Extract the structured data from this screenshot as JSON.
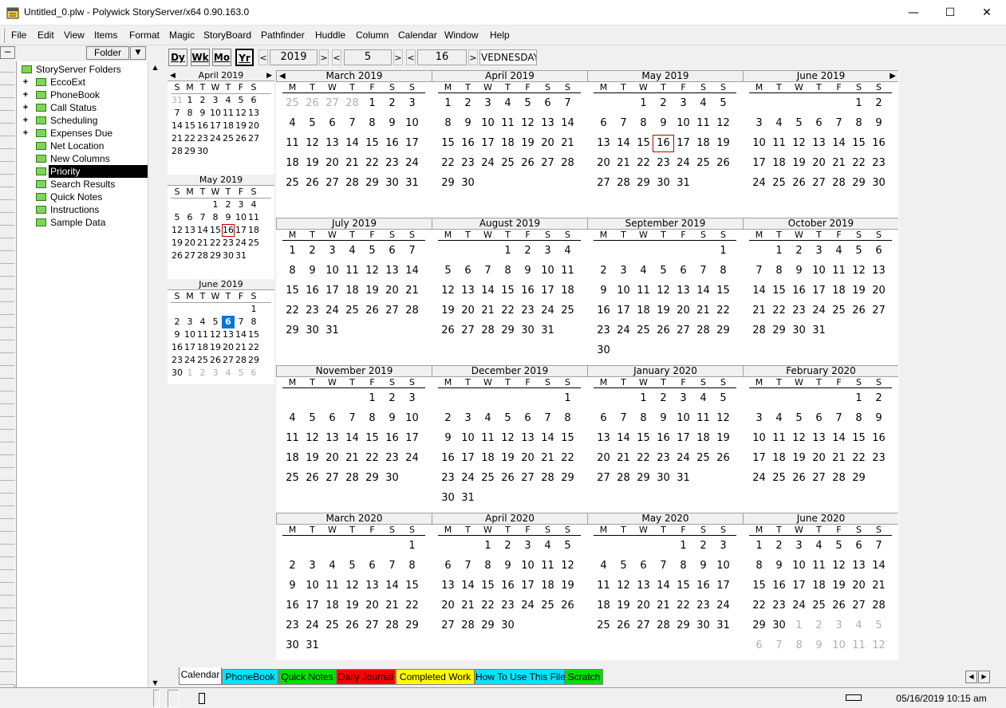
{
  "window": {
    "title": "Untitled_0.plw - Polywick StoryServer/x64 0.90.163.0",
    "minimize": "—",
    "maximize": "☐",
    "close": "✕"
  },
  "menu": [
    "File",
    "Edit",
    "View",
    "Items",
    "Format",
    "Magic",
    "StoryBoard",
    "Pathfinder",
    "Huddle",
    "Column",
    "Calendar",
    "Window",
    "Help"
  ],
  "leftpane": {
    "collapse": "−",
    "header": "Folder",
    "dropdown": "▼",
    "tree": [
      {
        "label": "StoryServer Folders",
        "level": 0,
        "plus": false,
        "selected": false
      },
      {
        "label": "EccoExt",
        "level": 1,
        "plus": true,
        "selected": false
      },
      {
        "label": "PhoneBook",
        "level": 1,
        "plus": true,
        "selected": false
      },
      {
        "label": "Call Status",
        "level": 1,
        "plus": true,
        "selected": false
      },
      {
        "label": "Scheduling",
        "level": 1,
        "plus": true,
        "selected": false
      },
      {
        "label": "Expenses Due",
        "level": 1,
        "plus": true,
        "selected": false
      },
      {
        "label": "Net Location",
        "level": 1,
        "plus": false,
        "selected": false
      },
      {
        "label": "New Columns",
        "level": 1,
        "plus": false,
        "selected": false
      },
      {
        "label": "Priority",
        "level": 1,
        "plus": false,
        "selected": true
      },
      {
        "label": "Search Results",
        "level": 1,
        "plus": false,
        "selected": false
      },
      {
        "label": "Quick Notes",
        "level": 1,
        "plus": false,
        "selected": false
      },
      {
        "label": "Instructions",
        "level": 1,
        "plus": false,
        "selected": false
      },
      {
        "label": "Sample Data",
        "level": 1,
        "plus": false,
        "selected": false
      }
    ]
  },
  "toolbar": {
    "day": "Dy",
    "week": "Wk",
    "month": "Mo",
    "year": "Yr",
    "year_value": "2019",
    "month_value": "5",
    "day_value": "16",
    "weekday": "VEDNESDAY"
  },
  "mini": [
    {
      "title": "April 2019",
      "head": [
        "S",
        "M",
        "T",
        "W",
        "T",
        "F",
        "S"
      ],
      "weeks": [
        [
          "31",
          "1",
          "2",
          "3",
          "4",
          "5",
          "6"
        ],
        [
          "7",
          "8",
          "9",
          "10",
          "11",
          "12",
          "13"
        ],
        [
          "14",
          "15",
          "16",
          "17",
          "18",
          "19",
          "20"
        ],
        [
          "21",
          "22",
          "23",
          "24",
          "25",
          "26",
          "27"
        ],
        [
          "28",
          "29",
          "30",
          "",
          "",
          "",
          ""
        ]
      ],
      "dim_first": 1
    },
    {
      "title": "May 2019",
      "head": [
        "S",
        "M",
        "T",
        "W",
        "T",
        "F",
        "S"
      ],
      "weeks": [
        [
          "",
          "",
          "",
          "1",
          "2",
          "3",
          "4"
        ],
        [
          "5",
          "6",
          "7",
          "8",
          "9",
          "10",
          "11"
        ],
        [
          "12",
          "13",
          "14",
          "15",
          "16",
          "17",
          "18"
        ],
        [
          "19",
          "20",
          "21",
          "22",
          "23",
          "24",
          "25"
        ],
        [
          "26",
          "27",
          "28",
          "29",
          "30",
          "31",
          ""
        ]
      ],
      "dim_first": 0
    },
    {
      "title": "June 2019",
      "head": [
        "S",
        "M",
        "T",
        "W",
        "T",
        "F",
        "S"
      ],
      "weeks": [
        [
          "",
          "",
          "",
          "",
          "",
          "",
          "1"
        ],
        [
          "2",
          "3",
          "4",
          "5",
          "6",
          "7",
          "8"
        ],
        [
          "9",
          "10",
          "11",
          "12",
          "13",
          "14",
          "15"
        ],
        [
          "16",
          "17",
          "18",
          "19",
          "20",
          "21",
          "22"
        ],
        [
          "23",
          "24",
          "25",
          "26",
          "27",
          "28",
          "29"
        ],
        [
          "30",
          "1",
          "2",
          "3",
          "4",
          "5",
          "6"
        ]
      ],
      "dim_first": 0
    }
  ],
  "year": {
    "head": [
      "M",
      "T",
      "W",
      "T",
      "F",
      "S",
      "S"
    ],
    "months": [
      {
        "title": "March 2019",
        "weeks": [
          [
            "25",
            "26",
            "27",
            "28",
            "1",
            "2",
            "3"
          ],
          [
            "4",
            "5",
            "6",
            "7",
            "8",
            "9",
            "10"
          ],
          [
            "11",
            "12",
            "13",
            "14",
            "15",
            "16",
            "17"
          ],
          [
            "18",
            "19",
            "20",
            "21",
            "22",
            "23",
            "24"
          ],
          [
            "25",
            "26",
            "27",
            "28",
            "29",
            "30",
            "31"
          ]
        ]
      },
      {
        "title": "April 2019",
        "weeks": [
          [
            "1",
            "2",
            "3",
            "4",
            "5",
            "6",
            "7"
          ],
          [
            "8",
            "9",
            "10",
            "11",
            "12",
            "13",
            "14"
          ],
          [
            "15",
            "16",
            "17",
            "18",
            "19",
            "20",
            "21"
          ],
          [
            "22",
            "23",
            "24",
            "25",
            "26",
            "27",
            "28"
          ],
          [
            "29",
            "30",
            "",
            "",
            "",
            "",
            ""
          ]
        ]
      },
      {
        "title": "May 2019",
        "weeks": [
          [
            "",
            "",
            "1",
            "2",
            "3",
            "4",
            "5"
          ],
          [
            "6",
            "7",
            "8",
            "9",
            "10",
            "11",
            "12"
          ],
          [
            "13",
            "14",
            "15",
            "16",
            "17",
            "18",
            "19"
          ],
          [
            "20",
            "21",
            "22",
            "23",
            "24",
            "25",
            "26"
          ],
          [
            "27",
            "28",
            "29",
            "30",
            "31",
            "",
            ""
          ]
        ]
      },
      {
        "title": "June 2019",
        "weeks": [
          [
            "",
            "",
            "",
            "",
            "",
            "1",
            "2"
          ],
          [
            "3",
            "4",
            "5",
            "6",
            "7",
            "8",
            "9"
          ],
          [
            "10",
            "11",
            "12",
            "13",
            "14",
            "15",
            "16"
          ],
          [
            "17",
            "18",
            "19",
            "20",
            "21",
            "22",
            "23"
          ],
          [
            "24",
            "25",
            "26",
            "27",
            "28",
            "29",
            "30"
          ]
        ]
      },
      {
        "title": "July 2019",
        "weeks": [
          [
            "1",
            "2",
            "3",
            "4",
            "5",
            "6",
            "7"
          ],
          [
            "8",
            "9",
            "10",
            "11",
            "12",
            "13",
            "14"
          ],
          [
            "15",
            "16",
            "17",
            "18",
            "19",
            "20",
            "21"
          ],
          [
            "22",
            "23",
            "24",
            "25",
            "26",
            "27",
            "28"
          ],
          [
            "29",
            "30",
            "31",
            "",
            "",
            "",
            ""
          ]
        ]
      },
      {
        "title": "August 2019",
        "weeks": [
          [
            "",
            "",
            "",
            "1",
            "2",
            "3",
            "4"
          ],
          [
            "5",
            "6",
            "7",
            "8",
            "9",
            "10",
            "11"
          ],
          [
            "12",
            "13",
            "14",
            "15",
            "16",
            "17",
            "18"
          ],
          [
            "19",
            "20",
            "21",
            "22",
            "23",
            "24",
            "25"
          ],
          [
            "26",
            "27",
            "28",
            "29",
            "30",
            "31",
            ""
          ]
        ]
      },
      {
        "title": "September 2019",
        "weeks": [
          [
            "",
            "",
            "",
            "",
            "",
            "",
            "1"
          ],
          [
            "2",
            "3",
            "4",
            "5",
            "6",
            "7",
            "8"
          ],
          [
            "9",
            "10",
            "11",
            "12",
            "13",
            "14",
            "15"
          ],
          [
            "16",
            "17",
            "18",
            "19",
            "20",
            "21",
            "22"
          ],
          [
            "23",
            "24",
            "25",
            "26",
            "27",
            "28",
            "29"
          ],
          [
            "30",
            "",
            "",
            "",
            "",
            "",
            ""
          ]
        ]
      },
      {
        "title": "October 2019",
        "weeks": [
          [
            "",
            "1",
            "2",
            "3",
            "4",
            "5",
            "6"
          ],
          [
            "7",
            "8",
            "9",
            "10",
            "11",
            "12",
            "13"
          ],
          [
            "14",
            "15",
            "16",
            "17",
            "18",
            "19",
            "20"
          ],
          [
            "21",
            "22",
            "23",
            "24",
            "25",
            "26",
            "27"
          ],
          [
            "28",
            "29",
            "30",
            "31",
            "",
            "",
            ""
          ]
        ]
      },
      {
        "title": "November 2019",
        "weeks": [
          [
            "",
            "",
            "",
            "",
            "1",
            "2",
            "3"
          ],
          [
            "4",
            "5",
            "6",
            "7",
            "8",
            "9",
            "10"
          ],
          [
            "11",
            "12",
            "13",
            "14",
            "15",
            "16",
            "17"
          ],
          [
            "18",
            "19",
            "20",
            "21",
            "22",
            "23",
            "24"
          ],
          [
            "25",
            "26",
            "27",
            "28",
            "29",
            "30",
            ""
          ]
        ]
      },
      {
        "title": "December 2019",
        "weeks": [
          [
            "",
            "",
            "",
            "",
            "",
            "",
            "1"
          ],
          [
            "2",
            "3",
            "4",
            "5",
            "6",
            "7",
            "8"
          ],
          [
            "9",
            "10",
            "11",
            "12",
            "13",
            "14",
            "15"
          ],
          [
            "16",
            "17",
            "18",
            "19",
            "20",
            "21",
            "22"
          ],
          [
            "23",
            "24",
            "25",
            "26",
            "27",
            "28",
            "29"
          ],
          [
            "30",
            "31",
            "",
            "",
            "",
            "",
            ""
          ]
        ]
      },
      {
        "title": "January 2020",
        "weeks": [
          [
            "",
            "",
            "1",
            "2",
            "3",
            "4",
            "5"
          ],
          [
            "6",
            "7",
            "8",
            "9",
            "10",
            "11",
            "12"
          ],
          [
            "13",
            "14",
            "15",
            "16",
            "17",
            "18",
            "19"
          ],
          [
            "20",
            "21",
            "22",
            "23",
            "24",
            "25",
            "26"
          ],
          [
            "27",
            "28",
            "29",
            "30",
            "31",
            "",
            ""
          ]
        ]
      },
      {
        "title": "February 2020",
        "weeks": [
          [
            "",
            "",
            "",
            "",
            "",
            "1",
            "2"
          ],
          [
            "3",
            "4",
            "5",
            "6",
            "7",
            "8",
            "9"
          ],
          [
            "10",
            "11",
            "12",
            "13",
            "14",
            "15",
            "16"
          ],
          [
            "17",
            "18",
            "19",
            "20",
            "21",
            "22",
            "23"
          ],
          [
            "24",
            "25",
            "26",
            "27",
            "28",
            "29",
            ""
          ]
        ]
      },
      {
        "title": "March 2020",
        "weeks": [
          [
            "",
            "",
            "",
            "",
            "",
            "",
            "1"
          ],
          [
            "2",
            "3",
            "4",
            "5",
            "6",
            "7",
            "8"
          ],
          [
            "9",
            "10",
            "11",
            "12",
            "13",
            "14",
            "15"
          ],
          [
            "16",
            "17",
            "18",
            "19",
            "20",
            "21",
            "22"
          ],
          [
            "23",
            "24",
            "25",
            "26",
            "27",
            "28",
            "29"
          ],
          [
            "30",
            "31",
            "",
            "",
            "",
            "",
            ""
          ]
        ]
      },
      {
        "title": "April 2020",
        "weeks": [
          [
            "",
            "",
            "1",
            "2",
            "3",
            "4",
            "5"
          ],
          [
            "6",
            "7",
            "8",
            "9",
            "10",
            "11",
            "12"
          ],
          [
            "13",
            "14",
            "15",
            "16",
            "17",
            "18",
            "19"
          ],
          [
            "20",
            "21",
            "22",
            "23",
            "24",
            "25",
            "26"
          ],
          [
            "27",
            "28",
            "29",
            "30",
            "",
            "",
            ""
          ]
        ]
      },
      {
        "title": "May 2020",
        "weeks": [
          [
            "",
            "",
            "",
            "",
            "1",
            "2",
            "3"
          ],
          [
            "4",
            "5",
            "6",
            "7",
            "8",
            "9",
            "10"
          ],
          [
            "11",
            "12",
            "13",
            "14",
            "15",
            "16",
            "17"
          ],
          [
            "18",
            "19",
            "20",
            "21",
            "22",
            "23",
            "24"
          ],
          [
            "25",
            "26",
            "27",
            "28",
            "29",
            "30",
            "31"
          ]
        ]
      },
      {
        "title": "June 2020",
        "weeks": [
          [
            "1",
            "2",
            "3",
            "4",
            "5",
            "6",
            "7"
          ],
          [
            "8",
            "9",
            "10",
            "11",
            "12",
            "13",
            "14"
          ],
          [
            "15",
            "16",
            "17",
            "18",
            "19",
            "20",
            "21"
          ],
          [
            "22",
            "23",
            "24",
            "25",
            "26",
            "27",
            "28"
          ],
          [
            "29",
            "30",
            "1",
            "2",
            "3",
            "4",
            "5"
          ],
          [
            "6",
            "7",
            "8",
            "9",
            "10",
            "11",
            "12"
          ]
        ]
      }
    ]
  },
  "tabs": [
    {
      "label": "Calendar",
      "color": "#ffffff"
    },
    {
      "label": "PhoneBook",
      "color": "#00e5ff"
    },
    {
      "label": "Quick Notes",
      "color": "#00e000"
    },
    {
      "label": "Daily Journal",
      "color": "#ff0000"
    },
    {
      "label": "Completed Work",
      "color": "#ffff00"
    },
    {
      "label": "How To Use This File",
      "color": "#00e5ff"
    },
    {
      "label": "Scratch",
      "color": "#00e000"
    }
  ],
  "status": {
    "datetime": "05/16/2019 10:15 am"
  }
}
